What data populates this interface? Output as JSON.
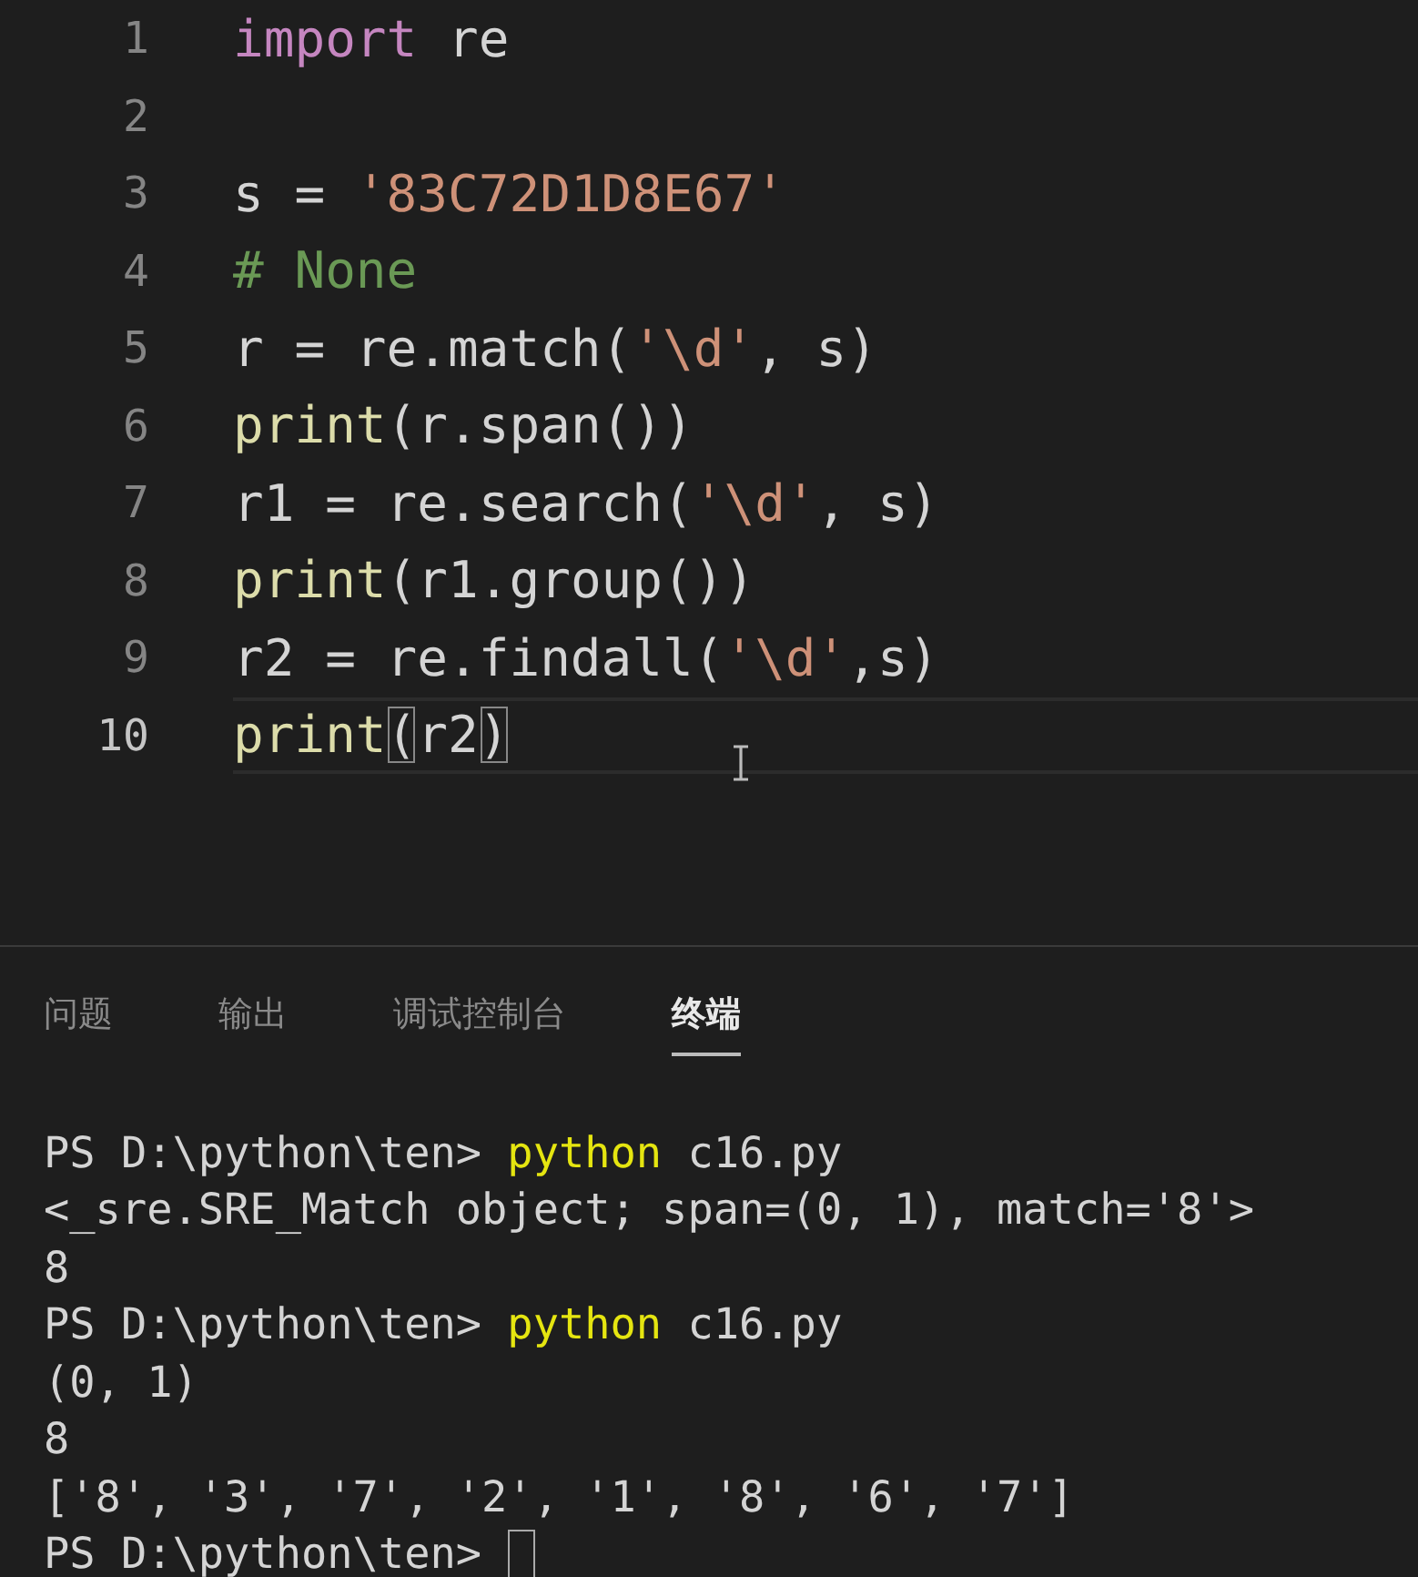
{
  "editor": {
    "lines": [
      {
        "number": "1",
        "current": false,
        "tokens": [
          {
            "kind": "keyword",
            "text": "import"
          },
          {
            "kind": "plain",
            "text": " re"
          }
        ]
      },
      {
        "number": "2",
        "current": false
      },
      {
        "number": "3",
        "current": false,
        "tokens": [
          {
            "kind": "plain",
            "text": "s = "
          },
          {
            "kind": "string",
            "text": "'83C72D1D8E67'"
          }
        ]
      },
      {
        "number": "4",
        "current": false,
        "tokens": [
          {
            "kind": "comment",
            "text": "# None"
          }
        ]
      },
      {
        "number": "5",
        "current": false,
        "tokens": [
          {
            "kind": "plain",
            "text": "r = re.match("
          },
          {
            "kind": "string",
            "text": "'\\d'"
          },
          {
            "kind": "plain",
            "text": ", s)"
          }
        ]
      },
      {
        "number": "6",
        "current": false,
        "tokens": [
          {
            "kind": "function",
            "text": "print"
          },
          {
            "kind": "plain",
            "text": "(r.span())"
          }
        ]
      },
      {
        "number": "7",
        "current": false,
        "tokens": [
          {
            "kind": "plain",
            "text": "r1 = re.search("
          },
          {
            "kind": "string",
            "text": "'\\d'"
          },
          {
            "kind": "plain",
            "text": ", s)"
          }
        ]
      },
      {
        "number": "8",
        "current": false,
        "tokens": [
          {
            "kind": "function",
            "text": "print"
          },
          {
            "kind": "plain",
            "text": "(r1.group())"
          }
        ]
      },
      {
        "number": "9",
        "current": false,
        "tokens": [
          {
            "kind": "plain",
            "text": "r2 = re.findall("
          },
          {
            "kind": "string",
            "text": "'\\d'"
          },
          {
            "kind": "plain",
            "text": ",s)"
          }
        ]
      },
      {
        "number": "10",
        "current": true,
        "tokens": [
          {
            "kind": "function",
            "text": "print"
          },
          {
            "kind": "bracket",
            "text": "("
          },
          {
            "kind": "plain",
            "text": "r2"
          },
          {
            "kind": "bracket",
            "text": ")"
          }
        ]
      }
    ]
  },
  "panel": {
    "tabs": [
      {
        "label": "问题",
        "selected": false
      },
      {
        "label": "输出",
        "selected": false
      },
      {
        "label": "调试控制台",
        "selected": false
      },
      {
        "label": "终端",
        "selected": true
      }
    ]
  },
  "terminal": {
    "lines": [
      {
        "cursor": false,
        "tokens": [
          {
            "kind": "plain",
            "text": "PS D:\\python\\ten> "
          },
          {
            "kind": "command",
            "text": "python"
          },
          {
            "kind": "plain",
            "text": " c16.py"
          }
        ]
      },
      {
        "cursor": false,
        "tokens": [
          {
            "kind": "plain",
            "text": "<_sre.SRE_Match object; span=(0, 1), match='8'>"
          }
        ]
      },
      {
        "cursor": false,
        "tokens": [
          {
            "kind": "plain",
            "text": "8"
          }
        ]
      },
      {
        "cursor": false,
        "tokens": [
          {
            "kind": "plain",
            "text": "PS D:\\python\\ten> "
          },
          {
            "kind": "command",
            "text": "python"
          },
          {
            "kind": "plain",
            "text": " c16.py"
          }
        ]
      },
      {
        "cursor": false,
        "tokens": [
          {
            "kind": "plain",
            "text": "(0, 1)"
          }
        ]
      },
      {
        "cursor": false,
        "tokens": [
          {
            "kind": "plain",
            "text": "8"
          }
        ]
      },
      {
        "cursor": false,
        "tokens": [
          {
            "kind": "plain",
            "text": "['8', '3', '7', '2', '1', '8', '6', '7']"
          }
        ]
      },
      {
        "cursor": true,
        "tokens": [
          {
            "kind": "plain",
            "text": "PS D:\\python\\ten>"
          }
        ]
      }
    ]
  }
}
